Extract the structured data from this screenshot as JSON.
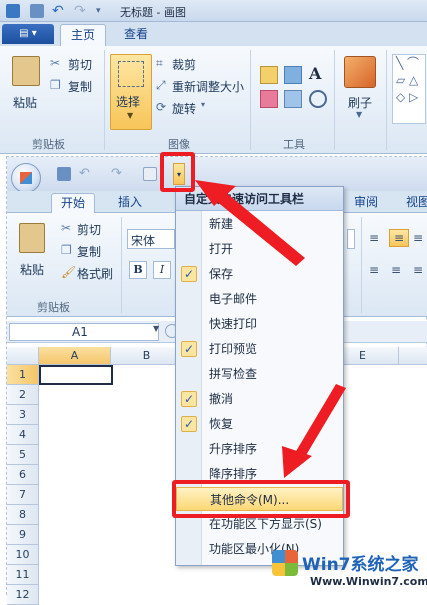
{
  "paint": {
    "title": "无标题 - 画图",
    "file_tab": "",
    "tabs": [
      "主页",
      "查看"
    ],
    "clipboard": {
      "paste": "粘贴",
      "cut": "剪切",
      "copy": "复制",
      "label": "剪贴板"
    },
    "image": {
      "select": "选择",
      "crop": "裁剪",
      "resize": "重新调整大小",
      "rotate": "旋转",
      "label": "图像"
    },
    "tools": {
      "label": "工具"
    },
    "brushes": {
      "label": "刷子"
    }
  },
  "excel": {
    "tabs": [
      "开始",
      "插入",
      "审阅",
      "视图"
    ],
    "clipboard": {
      "paste": "粘贴",
      "cut": "剪切",
      "copy": "复制",
      "format_painter": "格式刷",
      "label": "剪贴板"
    },
    "font": {
      "name": "宋体",
      "bold": "B",
      "italic": "I"
    },
    "name_box": "A1",
    "columns": [
      "A",
      "B",
      "E"
    ],
    "rows": [
      "1",
      "2",
      "3",
      "4",
      "5",
      "6",
      "7",
      "8",
      "9",
      "10",
      "11",
      "12"
    ]
  },
  "menu": {
    "title": "自定义快速访问工具栏",
    "items": [
      {
        "label": "新建",
        "checked": false
      },
      {
        "label": "打开",
        "checked": false
      },
      {
        "label": "保存",
        "checked": true
      },
      {
        "label": "电子邮件",
        "checked": false
      },
      {
        "label": "快速打印",
        "checked": false
      },
      {
        "label": "打印预览",
        "checked": true
      },
      {
        "label": "拼写检查",
        "checked": false
      },
      {
        "label": "撤消",
        "checked": true
      },
      {
        "label": "恢复",
        "checked": true
      },
      {
        "label": "升序排序",
        "checked": false
      },
      {
        "label": "降序排序",
        "checked": false
      },
      {
        "label": "其他命令(M)...",
        "checked": false
      },
      {
        "label": "在功能区下方显示(S)",
        "checked": false
      },
      {
        "label": "功能区最小化(N)",
        "checked": false
      }
    ]
  },
  "watermark": {
    "brand": "Win7系统之家",
    "url": "Www.Winwin7.com"
  },
  "colors": {
    "highlight": "#fcd875",
    "annotation_red": "#ee1d23",
    "ribbon_blue": "#dbe7f4"
  }
}
